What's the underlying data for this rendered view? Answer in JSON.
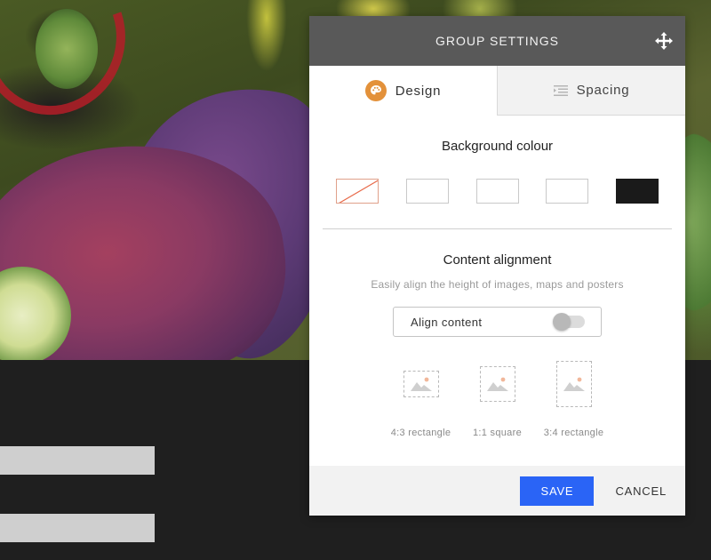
{
  "panel": {
    "title": "GROUP SETTINGS",
    "move_icon": "move-arrows-icon"
  },
  "tabs": [
    {
      "label": "Design",
      "icon": "palette-icon",
      "active": true
    },
    {
      "label": "Spacing",
      "icon": "list-indent-icon",
      "active": false
    }
  ],
  "background": {
    "title": "Background colour",
    "swatches": [
      {
        "name": "none",
        "color": "none"
      },
      {
        "name": "white-1",
        "color": "#ffffff"
      },
      {
        "name": "white-2",
        "color": "#ffffff"
      },
      {
        "name": "white-3",
        "color": "#ffffff"
      },
      {
        "name": "black",
        "color": "#1a1a1a"
      }
    ]
  },
  "alignment": {
    "title": "Content alignment",
    "subtitle": "Easily align the height of images, maps and posters",
    "toggle_label": "Align content",
    "toggle_on": false,
    "ratios": [
      {
        "label": "4:3 rectangle",
        "icon": "image-icon"
      },
      {
        "label": "1:1 square",
        "icon": "image-icon"
      },
      {
        "label": "3:4 rectangle",
        "icon": "image-icon"
      }
    ]
  },
  "footer": {
    "save_label": "SAVE",
    "cancel_label": "CANCEL"
  },
  "colors": {
    "header": "#595959",
    "accent": "#2a64f6",
    "palette_icon": "#e3913a"
  }
}
